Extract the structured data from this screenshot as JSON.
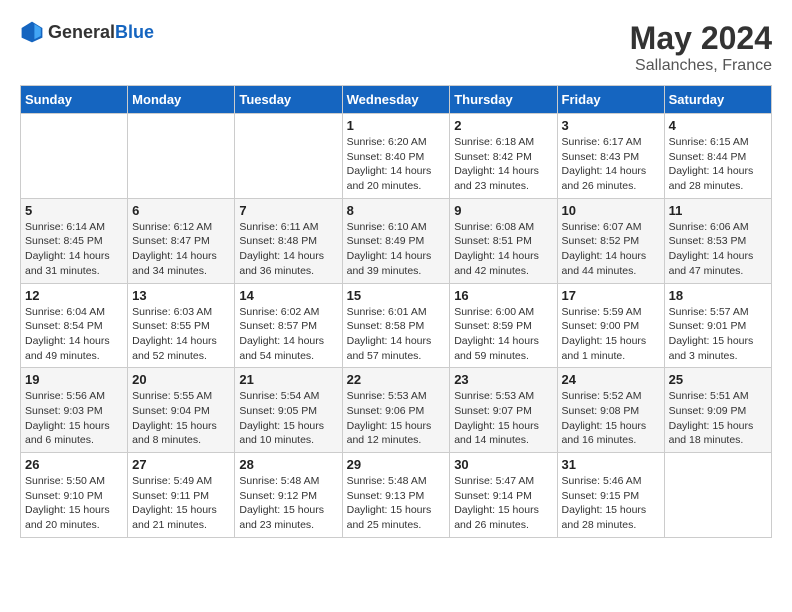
{
  "logo": {
    "general": "General",
    "blue": "Blue"
  },
  "title": {
    "month_year": "May 2024",
    "location": "Sallanches, France"
  },
  "headers": [
    "Sunday",
    "Monday",
    "Tuesday",
    "Wednesday",
    "Thursday",
    "Friday",
    "Saturday"
  ],
  "weeks": [
    [
      {
        "day": "",
        "info": ""
      },
      {
        "day": "",
        "info": ""
      },
      {
        "day": "",
        "info": ""
      },
      {
        "day": "1",
        "info": "Sunrise: 6:20 AM\nSunset: 8:40 PM\nDaylight: 14 hours\nand 20 minutes."
      },
      {
        "day": "2",
        "info": "Sunrise: 6:18 AM\nSunset: 8:42 PM\nDaylight: 14 hours\nand 23 minutes."
      },
      {
        "day": "3",
        "info": "Sunrise: 6:17 AM\nSunset: 8:43 PM\nDaylight: 14 hours\nand 26 minutes."
      },
      {
        "day": "4",
        "info": "Sunrise: 6:15 AM\nSunset: 8:44 PM\nDaylight: 14 hours\nand 28 minutes."
      }
    ],
    [
      {
        "day": "5",
        "info": "Sunrise: 6:14 AM\nSunset: 8:45 PM\nDaylight: 14 hours\nand 31 minutes."
      },
      {
        "day": "6",
        "info": "Sunrise: 6:12 AM\nSunset: 8:47 PM\nDaylight: 14 hours\nand 34 minutes."
      },
      {
        "day": "7",
        "info": "Sunrise: 6:11 AM\nSunset: 8:48 PM\nDaylight: 14 hours\nand 36 minutes."
      },
      {
        "day": "8",
        "info": "Sunrise: 6:10 AM\nSunset: 8:49 PM\nDaylight: 14 hours\nand 39 minutes."
      },
      {
        "day": "9",
        "info": "Sunrise: 6:08 AM\nSunset: 8:51 PM\nDaylight: 14 hours\nand 42 minutes."
      },
      {
        "day": "10",
        "info": "Sunrise: 6:07 AM\nSunset: 8:52 PM\nDaylight: 14 hours\nand 44 minutes."
      },
      {
        "day": "11",
        "info": "Sunrise: 6:06 AM\nSunset: 8:53 PM\nDaylight: 14 hours\nand 47 minutes."
      }
    ],
    [
      {
        "day": "12",
        "info": "Sunrise: 6:04 AM\nSunset: 8:54 PM\nDaylight: 14 hours\nand 49 minutes."
      },
      {
        "day": "13",
        "info": "Sunrise: 6:03 AM\nSunset: 8:55 PM\nDaylight: 14 hours\nand 52 minutes."
      },
      {
        "day": "14",
        "info": "Sunrise: 6:02 AM\nSunset: 8:57 PM\nDaylight: 14 hours\nand 54 minutes."
      },
      {
        "day": "15",
        "info": "Sunrise: 6:01 AM\nSunset: 8:58 PM\nDaylight: 14 hours\nand 57 minutes."
      },
      {
        "day": "16",
        "info": "Sunrise: 6:00 AM\nSunset: 8:59 PM\nDaylight: 14 hours\nand 59 minutes."
      },
      {
        "day": "17",
        "info": "Sunrise: 5:59 AM\nSunset: 9:00 PM\nDaylight: 15 hours\nand 1 minute."
      },
      {
        "day": "18",
        "info": "Sunrise: 5:57 AM\nSunset: 9:01 PM\nDaylight: 15 hours\nand 3 minutes."
      }
    ],
    [
      {
        "day": "19",
        "info": "Sunrise: 5:56 AM\nSunset: 9:03 PM\nDaylight: 15 hours\nand 6 minutes."
      },
      {
        "day": "20",
        "info": "Sunrise: 5:55 AM\nSunset: 9:04 PM\nDaylight: 15 hours\nand 8 minutes."
      },
      {
        "day": "21",
        "info": "Sunrise: 5:54 AM\nSunset: 9:05 PM\nDaylight: 15 hours\nand 10 minutes."
      },
      {
        "day": "22",
        "info": "Sunrise: 5:53 AM\nSunset: 9:06 PM\nDaylight: 15 hours\nand 12 minutes."
      },
      {
        "day": "23",
        "info": "Sunrise: 5:53 AM\nSunset: 9:07 PM\nDaylight: 15 hours\nand 14 minutes."
      },
      {
        "day": "24",
        "info": "Sunrise: 5:52 AM\nSunset: 9:08 PM\nDaylight: 15 hours\nand 16 minutes."
      },
      {
        "day": "25",
        "info": "Sunrise: 5:51 AM\nSunset: 9:09 PM\nDaylight: 15 hours\nand 18 minutes."
      }
    ],
    [
      {
        "day": "26",
        "info": "Sunrise: 5:50 AM\nSunset: 9:10 PM\nDaylight: 15 hours\nand 20 minutes."
      },
      {
        "day": "27",
        "info": "Sunrise: 5:49 AM\nSunset: 9:11 PM\nDaylight: 15 hours\nand 21 minutes."
      },
      {
        "day": "28",
        "info": "Sunrise: 5:48 AM\nSunset: 9:12 PM\nDaylight: 15 hours\nand 23 minutes."
      },
      {
        "day": "29",
        "info": "Sunrise: 5:48 AM\nSunset: 9:13 PM\nDaylight: 15 hours\nand 25 minutes."
      },
      {
        "day": "30",
        "info": "Sunrise: 5:47 AM\nSunset: 9:14 PM\nDaylight: 15 hours\nand 26 minutes."
      },
      {
        "day": "31",
        "info": "Sunrise: 5:46 AM\nSunset: 9:15 PM\nDaylight: 15 hours\nand 28 minutes."
      },
      {
        "day": "",
        "info": ""
      }
    ]
  ]
}
